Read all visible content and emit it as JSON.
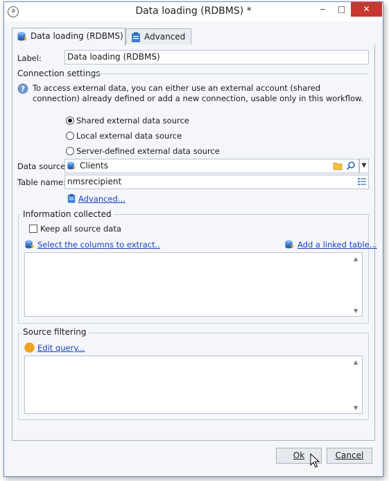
{
  "window": {
    "title": "Data loading (RDBMS) *",
    "minimize": "‒",
    "maximize": "□",
    "close": "✕"
  },
  "tabs": [
    {
      "label": "Data loading (RDBMS)",
      "active": true,
      "icon": "database-icon"
    },
    {
      "label": "Advanced",
      "active": false,
      "icon": "clipboard-icon"
    }
  ],
  "form": {
    "label_caption": "Label:",
    "label_value": "Data loading (RDBMS)",
    "connection_title": "Connection settings",
    "info_text": "To access external data, you can either use an external account (shared connection) already defined or add a new connection, usable only in this workflow.",
    "radios": [
      {
        "label": "Shared external data source",
        "checked": true
      },
      {
        "label": "Local external data source",
        "checked": false
      },
      {
        "label": "Server-defined external data source",
        "checked": false
      }
    ],
    "datasource_caption": "Data source:",
    "datasource_value": "Clients",
    "tablename_caption": "Table name:",
    "tablename_value": "nmsrecipient",
    "advanced_link": "Advanced..."
  },
  "info_collected": {
    "title": "Information collected",
    "keep_all_label": "Keep all source data",
    "keep_all_checked": false,
    "select_columns_link": "Select the columns to extract..",
    "add_linked_table_link": "Add a linked table..."
  },
  "source_filtering": {
    "title": "Source filtering",
    "edit_query_link": "Edit query..."
  },
  "buttons": {
    "ok_label": "Ok",
    "cancel_label": "Cancel"
  },
  "colors": {
    "accent_link": "#1a3fbf",
    "close_button": "#c7372f",
    "query_icon": "#f0a21e"
  }
}
